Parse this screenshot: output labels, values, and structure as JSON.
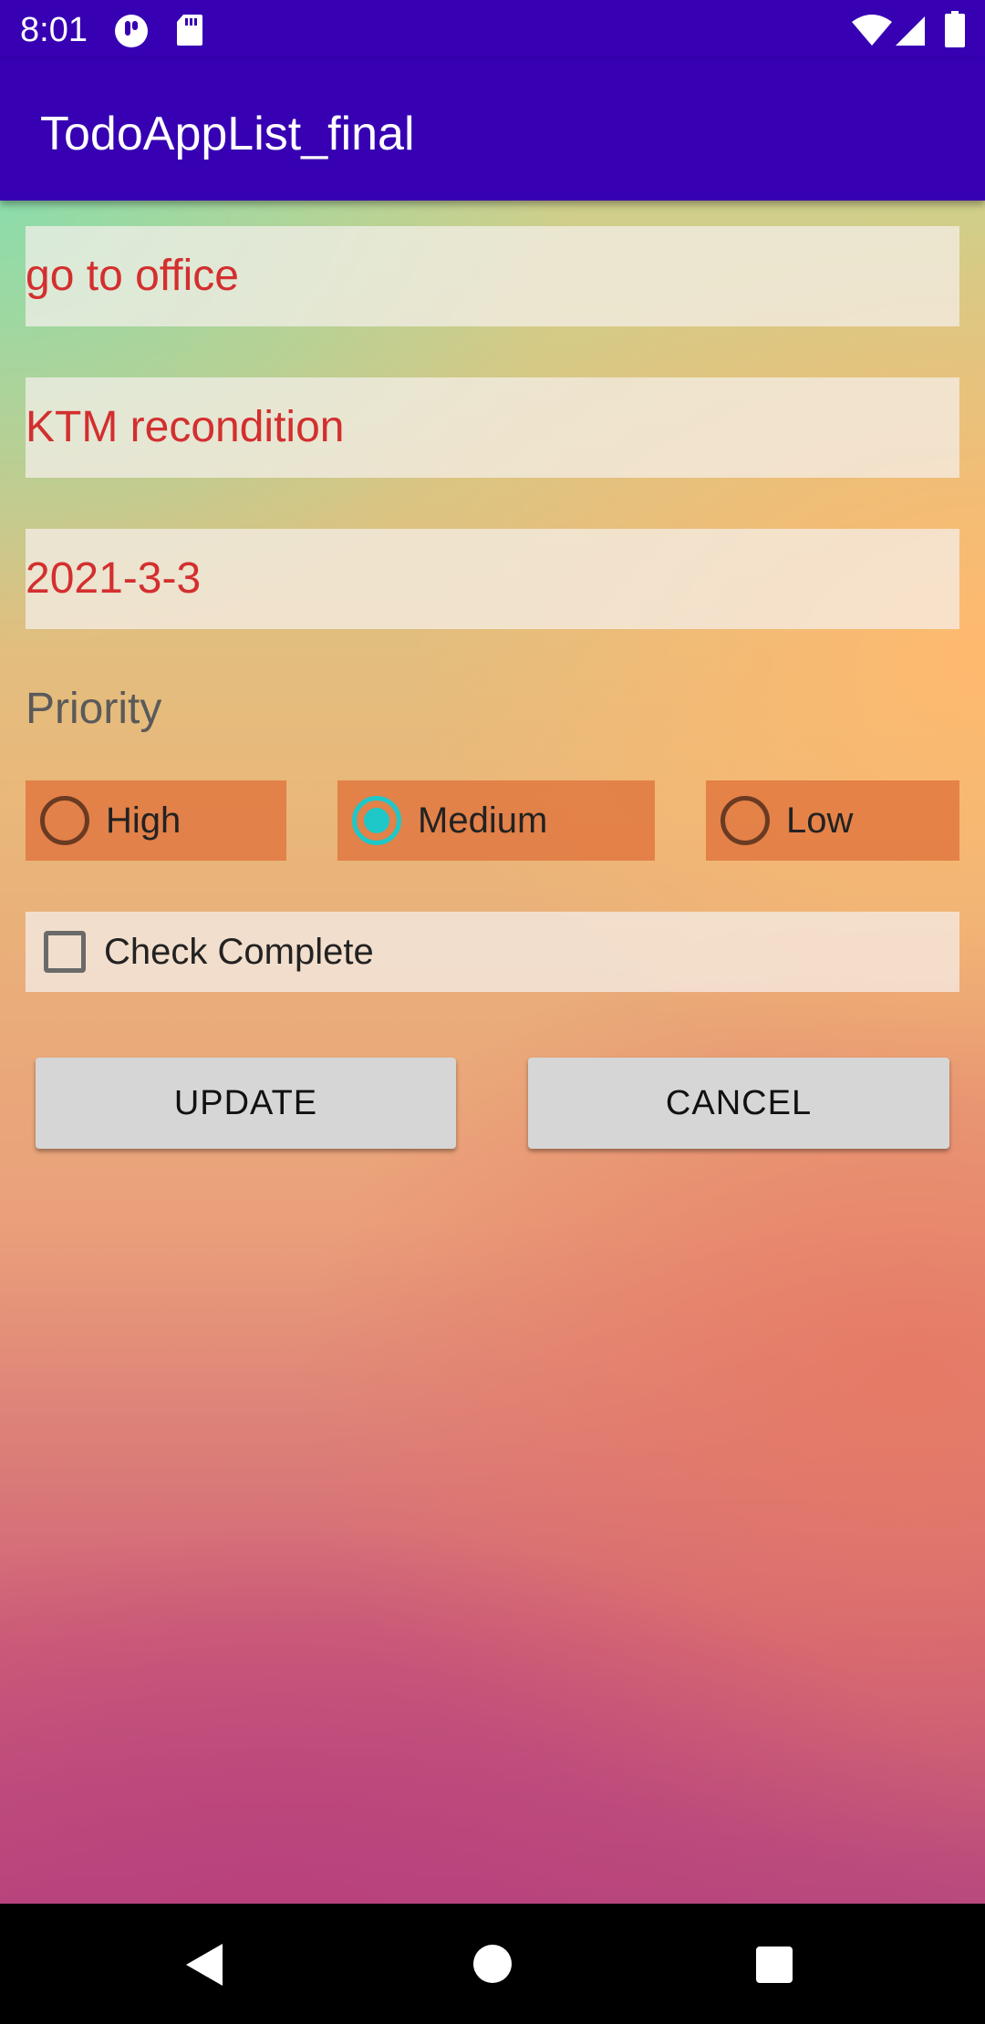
{
  "status_bar": {
    "time": "8:01",
    "left_icons": [
      "notification-app-icon",
      "sd-card-icon"
    ],
    "right_icons": [
      "wifi-icon",
      "cell-signal-icon",
      "battery-icon"
    ]
  },
  "app_bar": {
    "title": "TodoAppList_final"
  },
  "form": {
    "title_value": "go to office",
    "description_value": "KTM recondition",
    "date_value": "2021-3-3",
    "priority_label": "Priority",
    "priority_options": [
      {
        "label": "High",
        "selected": false
      },
      {
        "label": "Medium",
        "selected": true
      },
      {
        "label": "Low",
        "selected": false
      }
    ],
    "complete_label": "Check Complete",
    "complete_checked": false
  },
  "buttons": {
    "update": "UPDATE",
    "cancel": "CANCEL"
  },
  "nav_bar": {
    "icons": [
      "back-icon",
      "home-icon",
      "recents-icon"
    ]
  },
  "colors": {
    "app_bar": "#3700b3",
    "field_text": "#d32f2f",
    "radio_selected": "#1ec8c8",
    "button_bg": "#d6d6d6"
  }
}
